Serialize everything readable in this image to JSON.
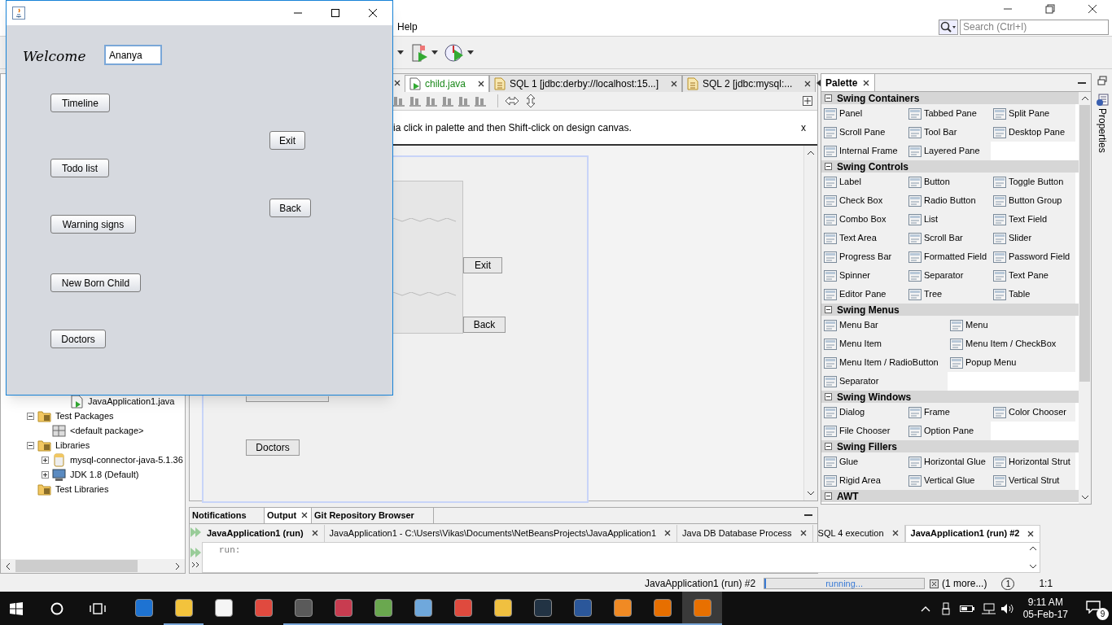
{
  "ide": {
    "menu": [
      "Help"
    ],
    "search": {
      "placeholder": "Search (Ctrl+I)"
    },
    "editor_tabs": [
      {
        "label": "child.java",
        "selected": true,
        "kind": "java"
      },
      {
        "label": "SQL 1 [jdbc:derby://localhost:15...]",
        "selected": false,
        "kind": "sql"
      },
      {
        "label": "SQL 2 [jdbc:mysql:...",
        "selected": false,
        "kind": "sql"
      }
    ],
    "hint": "ia click in palette and then Shift-click on design canvas.",
    "hint_close": "x",
    "canvas_buttons": [
      {
        "label": "Exit",
        "kind": "right"
      },
      {
        "label": "Back",
        "kind": "right"
      },
      {
        "label": "Doctors",
        "kind": "left"
      }
    ],
    "partial_branch": [
      {
        "label": "JavaApplication1.java"
      }
    ],
    "tree": [
      {
        "label": "Test Packages",
        "expanded": true,
        "kind": "folder",
        "children": [
          {
            "label": "<default package>",
            "kind": "package"
          }
        ]
      },
      {
        "label": "Libraries",
        "expanded": true,
        "kind": "folder",
        "children": [
          {
            "label": "mysql-connector-java-5.1.36",
            "expanded": false,
            "kind": "jar"
          },
          {
            "label": "JDK 1.8 (Default)",
            "expanded": false,
            "kind": "jdk"
          }
        ]
      },
      {
        "label": "Test Libraries",
        "kind": "folder"
      }
    ],
    "palette": {
      "title": "Palette",
      "sections": [
        {
          "title": "Swing Containers",
          "expanded": true,
          "kind": "narrow",
          "items": [
            "Panel",
            "Tabbed Pane",
            "Split Pane",
            "Scroll Pane",
            "Tool Bar",
            "Desktop Pane",
            "Internal Frame",
            "Layered Pane"
          ]
        },
        {
          "title": "Swing Controls",
          "expanded": true,
          "kind": "narrow",
          "items": [
            "Label",
            "Button",
            "Toggle Button",
            "Check Box",
            "Radio Button",
            "Button Group",
            "Combo Box",
            "List",
            "Text Field",
            "Text Area",
            "Scroll Bar",
            "Slider",
            "Progress Bar",
            "Formatted Field",
            "Password Field",
            "Spinner",
            "Separator",
            "Text Pane",
            "Editor Pane",
            "Tree",
            "Table"
          ]
        },
        {
          "title": "Swing Menus",
          "expanded": true,
          "kind": "wide",
          "items": [
            "Menu Bar",
            "Menu",
            "Menu Item",
            "Menu Item / CheckBox",
            "Menu Item / RadioButton",
            "Popup Menu",
            "Separator"
          ]
        },
        {
          "title": "Swing Windows",
          "expanded": true,
          "kind": "narrow",
          "items": [
            "Dialog",
            "Frame",
            "Color Chooser",
            "File Chooser",
            "Option Pane"
          ]
        },
        {
          "title": "Swing Fillers",
          "expanded": true,
          "kind": "narrow",
          "items": [
            "Glue",
            "Horizontal Glue",
            "Horizontal Strut",
            "Rigid Area",
            "Vertical Glue",
            "Vertical Strut"
          ]
        },
        {
          "title": "AWT",
          "expanded": true
        }
      ]
    },
    "side_tab": "Properties",
    "output": {
      "tabs": [
        {
          "label": "Notifications",
          "selected": false,
          "closable": false
        },
        {
          "label": "Output",
          "selected": true,
          "closable": true
        },
        {
          "label": "Git Repository Browser",
          "selected": false,
          "closable": false
        }
      ],
      "runs": [
        {
          "label": "JavaApplication1 (run)",
          "selected": false,
          "running": true
        },
        {
          "label": "JavaApplication1 - C:\\Users\\Vikas\\Documents\\NetBeansProjects\\JavaApplication1",
          "selected": false,
          "running": false
        },
        {
          "label": "Java DB Database Process",
          "selected": false,
          "running": false
        },
        {
          "label": "SQL 4 execution",
          "selected": false,
          "running": false
        },
        {
          "label": "JavaApplication1 (run) #2",
          "selected": true,
          "running": true
        }
      ],
      "text": "run:"
    },
    "status": {
      "task": "JavaApplication1 (run) #2",
      "progress": "running...",
      "level": 0.01,
      "more": "(1 more...)",
      "notifications": "1",
      "position": "1:1"
    }
  },
  "app": {
    "welcome": "Welcome",
    "name": {
      "value": "Ananya",
      "focused": true
    },
    "buttons": [
      {
        "label": "Timeline",
        "kind": "left"
      },
      {
        "label": "Exit",
        "kind": "right"
      },
      {
        "label": "Todo list",
        "kind": "left"
      },
      {
        "label": "Back",
        "kind": "right"
      },
      {
        "label": "Warning signs",
        "kind": "left"
      },
      {
        "label": "New Born Child",
        "kind": "left"
      },
      {
        "label": "Doctors",
        "kind": "left"
      }
    ]
  },
  "taskbar": {
    "apps": [
      {
        "color": "#1e73d2",
        "running": false,
        "selected": false
      },
      {
        "color": "#f3c33c",
        "running": true,
        "selected": false
      },
      {
        "color": "#f5f5f5",
        "running": false,
        "selected": false
      },
      {
        "color": "#e04a3f",
        "running": false,
        "selected": false
      },
      {
        "color": "#5a5a5a",
        "running": true,
        "selected": false
      },
      {
        "color": "#c83c50",
        "running": true,
        "selected": false
      },
      {
        "color": "#6aa84f",
        "running": true,
        "selected": false
      },
      {
        "color": "#6fa8dc",
        "running": true,
        "selected": false
      },
      {
        "color": "#df4a3e",
        "running": true,
        "selected": false
      },
      {
        "color": "#f0c040",
        "running": true,
        "selected": false
      },
      {
        "color": "#223344",
        "running": true,
        "selected": false
      },
      {
        "color": "#2b579a",
        "running": true,
        "selected": false
      },
      {
        "color": "#f08a24",
        "running": true,
        "selected": false
      },
      {
        "color": "#e76f00",
        "running": true,
        "selected": false
      },
      {
        "color": "#e87000",
        "running": true,
        "selected": true
      }
    ],
    "time": "9:11 AM",
    "date": "05-Feb-17",
    "notifications": "9"
  }
}
